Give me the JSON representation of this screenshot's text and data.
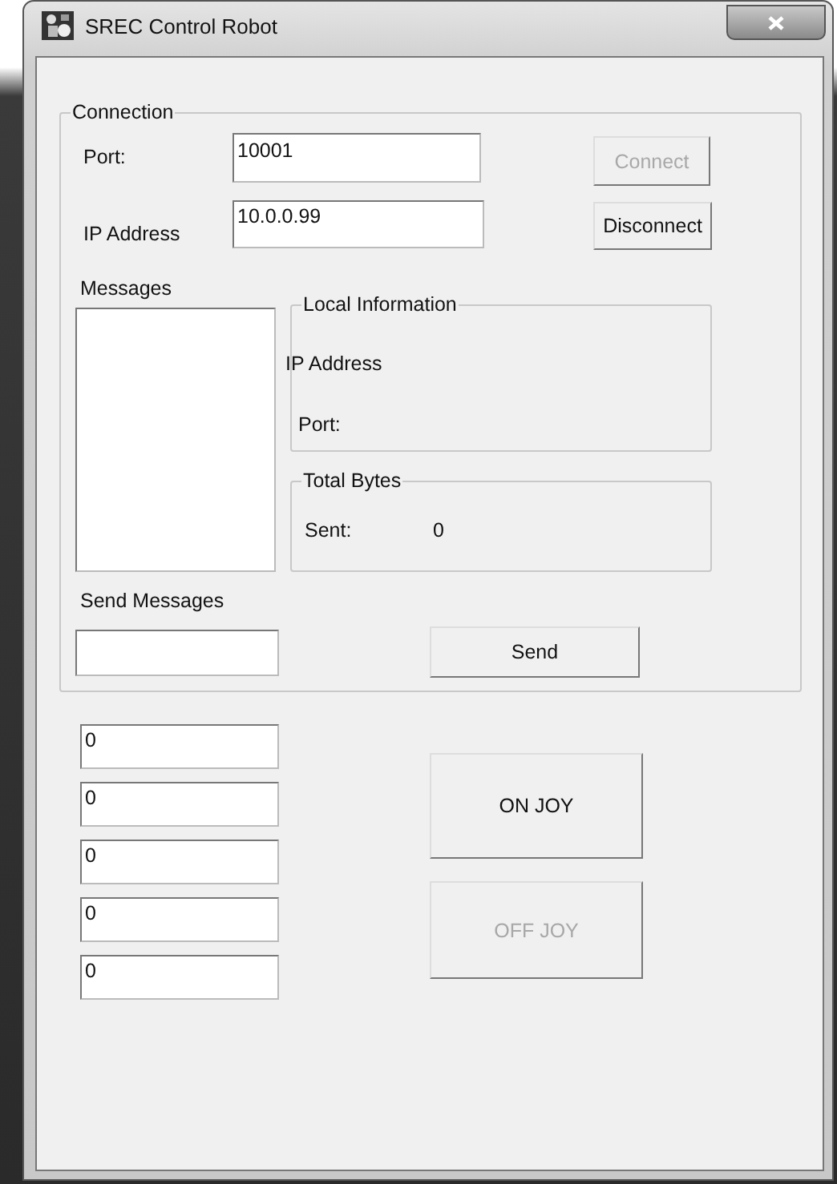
{
  "window": {
    "title": "SREC Control Robot"
  },
  "connection": {
    "title": "Connection",
    "port": {
      "label": "Port:",
      "value": "10001"
    },
    "ip": {
      "label": "IP Address",
      "value": "10.0.0.99"
    },
    "buttons": [
      {
        "label": "Connect",
        "disabled": true
      },
      {
        "label": "Disconnect",
        "disabled": false
      }
    ]
  },
  "messages": {
    "label": "Messages"
  },
  "local_information": {
    "title": "Local Information",
    "rows": [
      {
        "label": "IP Address"
      },
      {
        "label": "Port:"
      }
    ]
  },
  "total_bytes": {
    "title": "Total Bytes",
    "sent_label": "Sent:",
    "sent_value": "0"
  },
  "send_messages": {
    "label": "Send Messages",
    "button": "Send"
  },
  "joystick_fields": [
    "0",
    "0",
    "0",
    "0",
    "0"
  ],
  "joy_buttons": [
    {
      "label": "ON JOY",
      "disabled": false
    },
    {
      "label": "OFF JOY",
      "disabled": true
    }
  ]
}
